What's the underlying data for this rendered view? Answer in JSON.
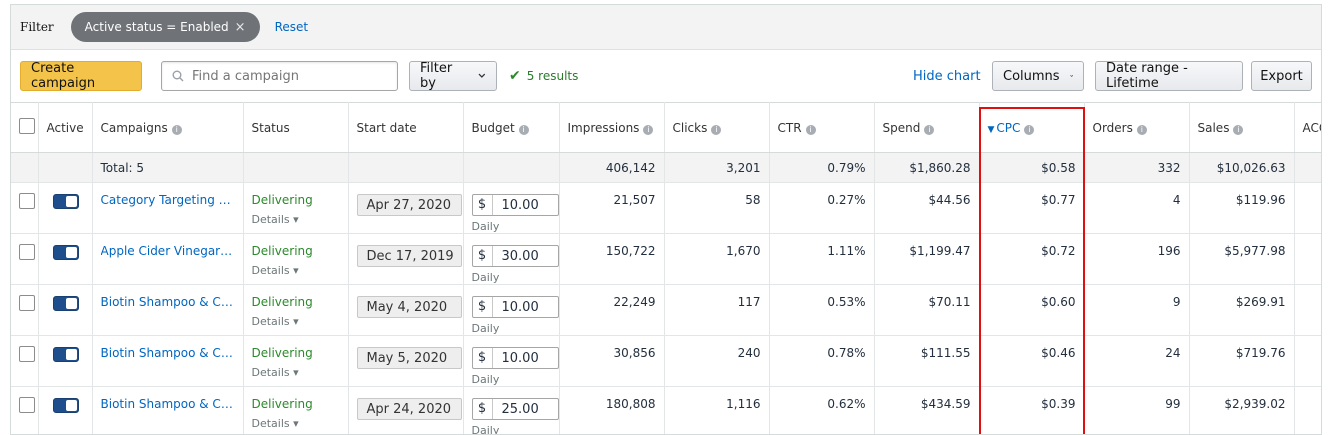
{
  "filter": {
    "label": "Filter",
    "chip_label": "Active status = Enabled",
    "chip_close": "×",
    "reset": "Reset"
  },
  "toolbar": {
    "create": "Create campaign",
    "search_placeholder": "Find a campaign",
    "filter_by": "Filter by",
    "results": "5 results",
    "hide_chart": "Hide chart",
    "columns": "Columns",
    "date_range": "Date range - Lifetime",
    "export": "Export"
  },
  "table": {
    "headers": {
      "active": "Active",
      "campaigns": "Campaigns",
      "status": "Status",
      "start_date": "Start date",
      "budget": "Budget",
      "impressions": "Impressions",
      "clicks": "Clicks",
      "ctr": "CTR",
      "spend": "Spend",
      "cpc": "CPC",
      "orders": "Orders",
      "sales": "Sales",
      "acos": "ACOS"
    },
    "total": {
      "label": "Total: 5",
      "impressions": "406,142",
      "clicks": "3,201",
      "ctr": "0.79%",
      "spend": "$1,860.28",
      "cpc": "$0.58",
      "orders": "332",
      "sales": "$10,026.63"
    },
    "rows": [
      {
        "campaign": "Category Targeting - Apple Cider Vinegar",
        "status": "Delivering",
        "details": "Details",
        "start_date": "Apr 27, 2020",
        "currency": "$",
        "budget": "10.00",
        "budget_type": "Daily",
        "impressions": "21,507",
        "clicks": "58",
        "ctr": "0.27%",
        "spend": "$44.56",
        "cpc": "$0.77",
        "orders": "4",
        "sales": "$119.96"
      },
      {
        "campaign": "Apple Cider Vinegar & Biotin Shampoo",
        "status": "Delivering",
        "details": "Details",
        "start_date": "Dec 17, 2019",
        "currency": "$",
        "budget": "30.00",
        "budget_type": "Daily",
        "impressions": "150,722",
        "clicks": "1,670",
        "ctr": "1.11%",
        "spend": "$1,199.47",
        "cpc": "$0.72",
        "orders": "196",
        "sales": "$5,977.98"
      },
      {
        "campaign": "Biotin Shampoo & Conditioner",
        "status": "Delivering",
        "details": "Details",
        "start_date": "May 4, 2020",
        "currency": "$",
        "budget": "10.00",
        "budget_type": "Daily",
        "impressions": "22,249",
        "clicks": "117",
        "ctr": "0.53%",
        "spend": "$70.11",
        "cpc": "$0.60",
        "orders": "9",
        "sales": "$269.91"
      },
      {
        "campaign": "Biotin Shampoo & Conditioner Set",
        "status": "Delivering",
        "details": "Details",
        "start_date": "May 5, 2020",
        "currency": "$",
        "budget": "10.00",
        "budget_type": "Daily",
        "impressions": "30,856",
        "clicks": "240",
        "ctr": "0.78%",
        "spend": "$111.55",
        "cpc": "$0.46",
        "orders": "24",
        "sales": "$719.76"
      },
      {
        "campaign": "Biotin Shampoo & Conditioner Kit",
        "status": "Delivering",
        "details": "Details",
        "start_date": "Apr 24, 2020",
        "currency": "$",
        "budget": "25.00",
        "budget_type": "Daily",
        "impressions": "180,808",
        "clicks": "1,116",
        "ctr": "0.62%",
        "spend": "$434.59",
        "cpc": "$0.39",
        "orders": "99",
        "sales": "$2,939.02"
      }
    ]
  },
  "colors": {
    "accent": "#0066c0",
    "primary_button": "#f4c34a",
    "status_green": "#2b8a2b",
    "highlight_box": "#e01010",
    "toggle_on": "#1e4e8c"
  },
  "icons": [
    "search-icon",
    "check-icon",
    "chevron-down-icon",
    "info-icon",
    "sort-desc-icon",
    "close-icon"
  ]
}
